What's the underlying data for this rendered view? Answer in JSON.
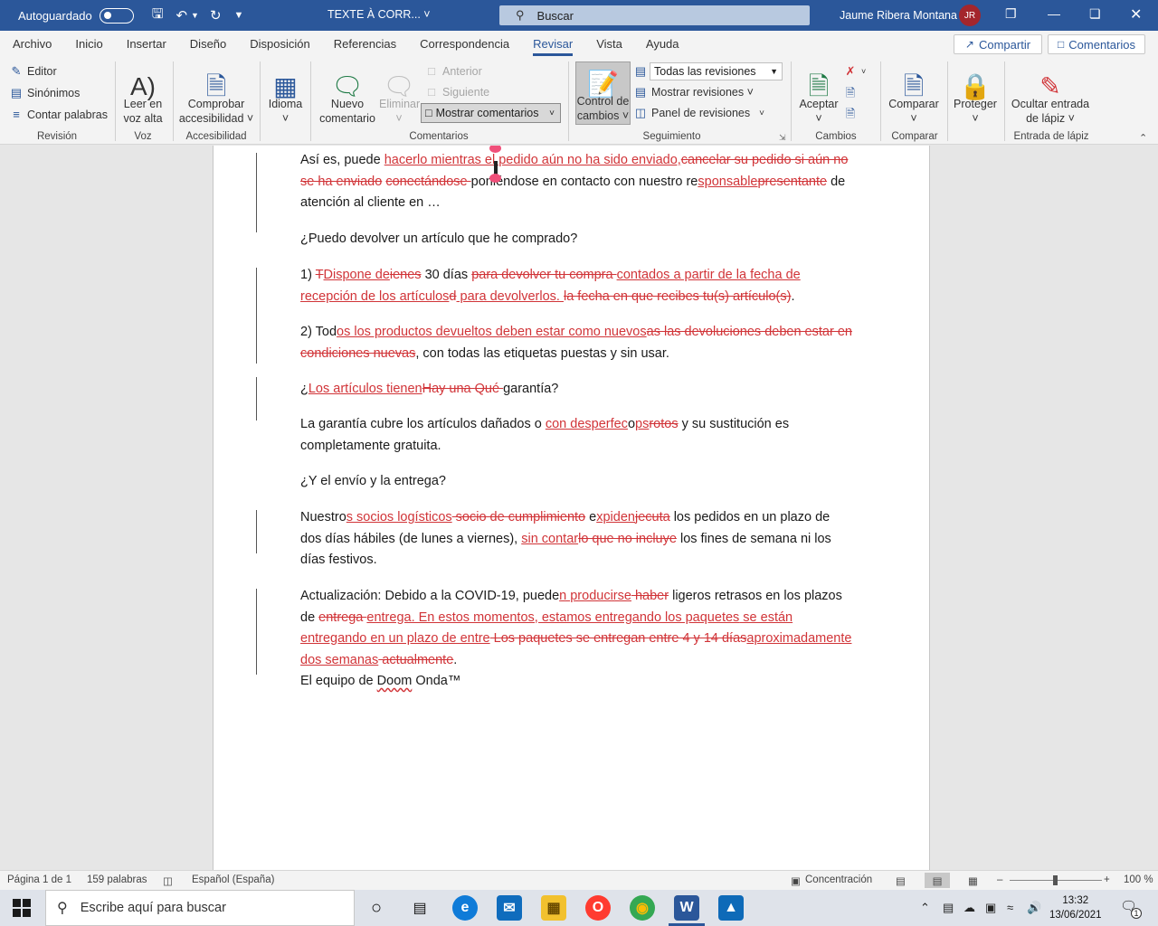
{
  "window": {
    "autosave_label": "Autoguardado",
    "doc_title": "TEXTE À CORR...",
    "search_placeholder": "Buscar",
    "user_name": "Jaume Ribera Montana",
    "user_initials": "JR"
  },
  "menu": {
    "tabs": [
      "Archivo",
      "Inicio",
      "Insertar",
      "Diseño",
      "Disposición",
      "Referencias",
      "Correspondencia",
      "Revisar",
      "Vista",
      "Ayuda"
    ],
    "active_tab": "Revisar",
    "share_label": "Compartir",
    "comments_label": "Comentarios"
  },
  "ribbon": {
    "revision": {
      "editor": "Editor",
      "synonyms": "Sinónimos",
      "word_count": "Contar palabras",
      "label": "Revisión"
    },
    "voice": {
      "read_aloud_1": "Leer en",
      "read_aloud_2": "voz alta",
      "label": "Voz"
    },
    "accessibility": {
      "check_1": "Comprobar",
      "check_2": "accesibilidad ˅",
      "label": "Accesibilidad"
    },
    "language": {
      "language": "Idioma",
      "label": ""
    },
    "comments": {
      "new_1": "Nuevo",
      "new_2": "comentario",
      "delete": "Eliminar",
      "previous": "Anterior",
      "next": "Siguiente",
      "show_comments": "Mostrar comentarios",
      "label": "Comentarios"
    },
    "tracking": {
      "track_1": "Control de",
      "track_2": "cambios ˅",
      "all_revisions": "Todas las revisiones",
      "show_markup": "Mostrar revisiones ˅",
      "review_pane": "Panel de revisiones",
      "label": "Seguimiento"
    },
    "changes": {
      "accept": "Aceptar",
      "label": "Cambios"
    },
    "compare": {
      "compare": "Comparar",
      "label": "Comparar"
    },
    "protect": {
      "protect": "Proteger",
      "label": ""
    },
    "ink": {
      "hide_1": "Ocultar entrada",
      "hide_2": "de lápiz ˅",
      "label": "Entrada de lápiz"
    }
  },
  "document": {
    "p1": {
      "t1": "Así es, puede ",
      "ins1": "hacerlo mientras el pedido aún no ha sido enviado,",
      "del1": "cancelar su pedido si aún no se ha enviado",
      "t2": " ",
      "del2": "conectándose ",
      "t3": "poniéndose en contacto con nuestro re",
      "ins2": "sponsable",
      "del3": "presentante",
      "t4": " de atención al cliente en …"
    },
    "q1": "¿Puedo devolver un artículo que he comprado?",
    "p2": {
      "t1": "1) ",
      "del1": "T",
      "ins1": "Dispone de",
      "del2": "ienes",
      "t2": " 30 días ",
      "del3": "para devolver tu compra ",
      "ins2": "contados a partir de la fecha de recepción de los artículos",
      "del4": "d",
      "ins3": " para devolverlos. ",
      "del5": "la fecha en que recibes tu(s) artículo(s)",
      "t3": "."
    },
    "p3": {
      "t1": "2) Tod",
      "ins1": "os los productos devueltos deben estar como nuevos",
      "del1": "as las devoluciones deben estar en condiciones nuevas",
      "t2": ", con todas las etiquetas puestas y sin usar."
    },
    "q2": {
      "t1": "¿",
      "ins1": "Los artículos tienen",
      "del1": "Hay una ",
      "del2": "Qué ",
      "t2": "garantía?"
    },
    "p4": {
      "t1": "La garantía cubre los artículos dañados o ",
      "ins1": "con desperfec",
      "t2": "o",
      "ins2": "ps",
      "del1": "rotos",
      "t3": " y su sustitución es completamente gratuita."
    },
    "q3": "¿Y el envío y la entrega?",
    "p5": {
      "t1": "Nuestro",
      "ins1": "s socios logísticos",
      "del1": " socio de cumplimiento",
      "t2": " e",
      "ins2": "xpiden",
      "del2": "jecuta",
      "t3": " los pedidos en un plazo de dos días hábiles (de lunes a viernes), ",
      "ins3": "sin contar",
      "del3": "lo que no incluye",
      "t4": " los fines de semana ni los días festivos."
    },
    "p6": {
      "t1": "Actualización: Debido a la COVID-19, puede",
      "ins1": "n producirse",
      "del1": " haber",
      "t2": " ligeros retrasos en los plazos de ",
      "del2": "entrega ",
      "ins2": "entrega. En estos momentos, estamos entregando los  paquetes",
      "ins3": " se están entregando en un plazo de entre",
      "del3": " Los paquetes se entregan entre 4 y 14 días",
      "ins4": "aproximadamente dos semanas",
      "del4": " actualmente",
      "t3": "."
    },
    "signature": {
      "t1": "El equipo de ",
      "t2": "Doom",
      "t3": " Onda™"
    }
  },
  "status": {
    "page": "Página 1 de 1",
    "words": "159 palabras",
    "language": "Español (España)",
    "focus": "Concentración",
    "zoom": "100 %",
    "zoom_level_percent": 100
  },
  "taskbar": {
    "search_placeholder": "Escribe aquí para buscar",
    "time": "13:32",
    "date": "13/06/2021",
    "notification_count": "1"
  }
}
